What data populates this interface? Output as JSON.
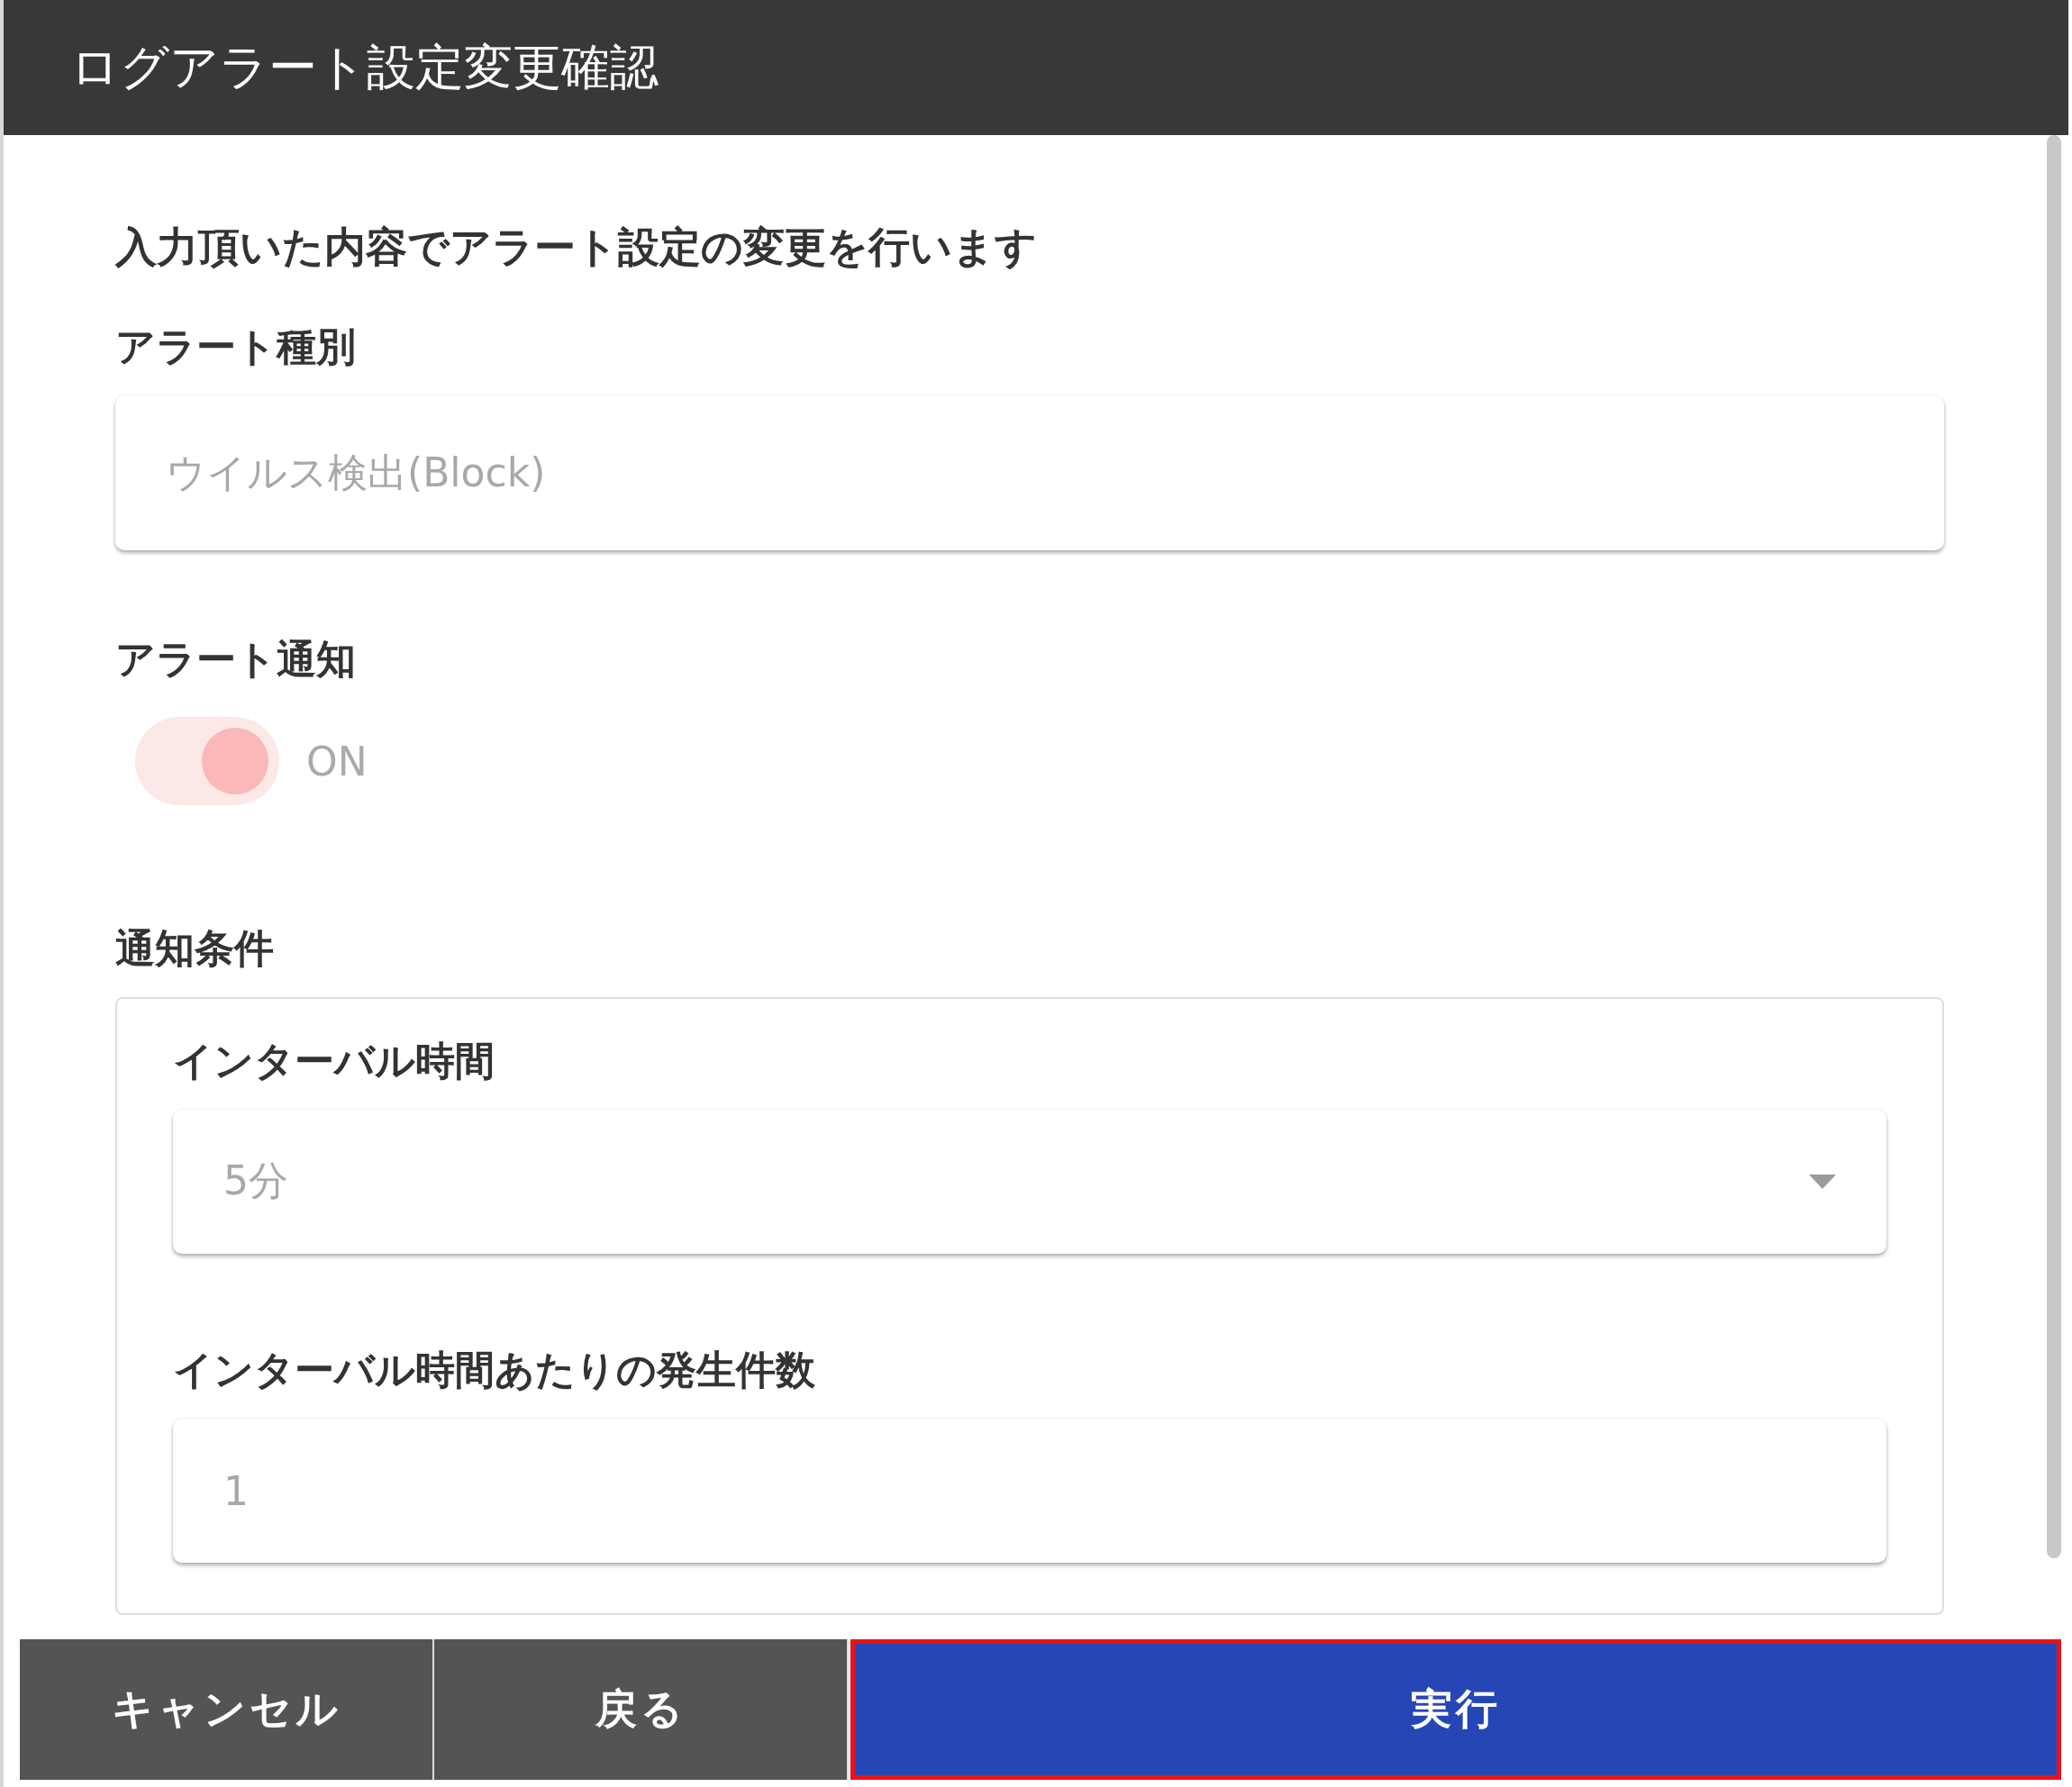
{
  "window": {
    "title": "ログアラート設定変更確認"
  },
  "message": "入力頂いた内容でアラート設定の変更を行います",
  "alert_type": {
    "label": "アラート種別",
    "value": "ウイルス検出(Block)",
    "disabled": true
  },
  "alert_notification": {
    "label": "アラート通知",
    "on": true,
    "disabled": true,
    "text": "ON"
  },
  "conditions": {
    "label": "通知条件",
    "fields": [
      {
        "kind": "select",
        "label": "インターバル時間",
        "value": "5分",
        "disabled": true
      },
      {
        "kind": "input",
        "label": "インターバル時間あたりの発生件数",
        "value": "1",
        "disabled": true
      }
    ]
  },
  "buttons": [
    {
      "label": "キャンセル",
      "kind": "secondary",
      "highlighted": false
    },
    {
      "label": "戻る",
      "kind": "secondary",
      "highlighted": false
    },
    {
      "label": "実行",
      "kind": "primary",
      "highlighted": true
    }
  ]
}
